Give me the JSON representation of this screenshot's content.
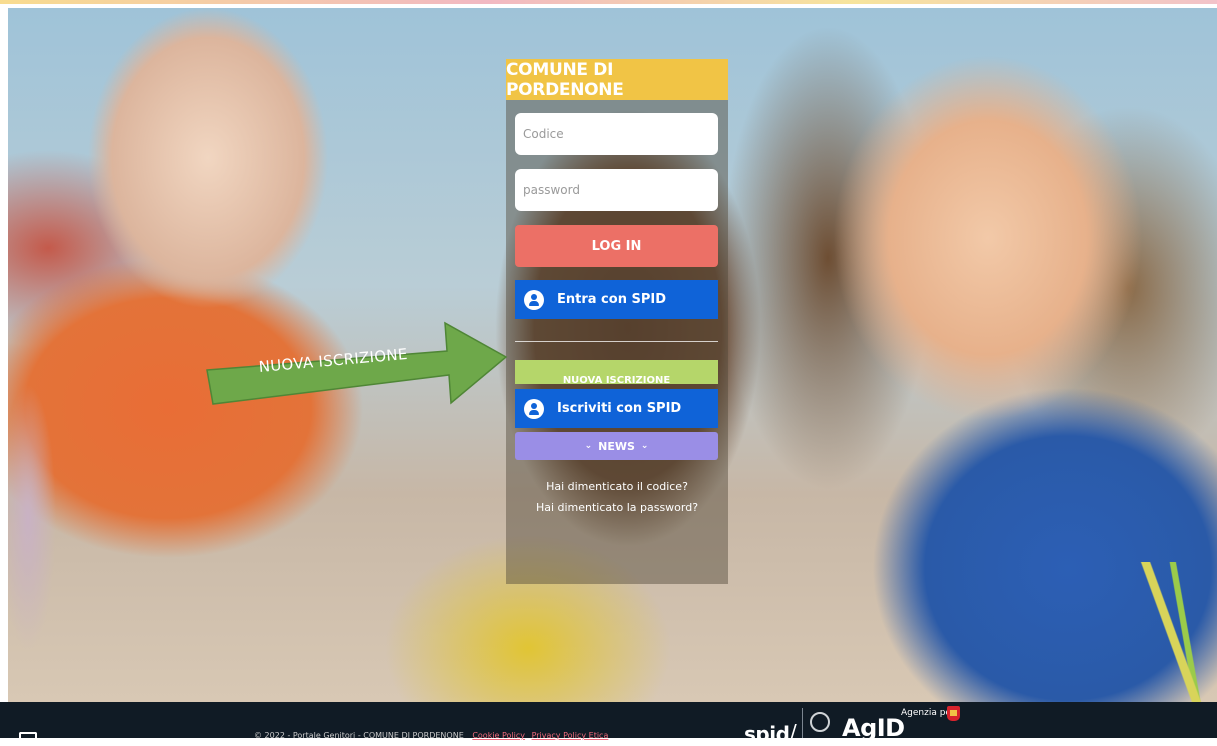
{
  "header": {
    "title": "COMUNE DI PORDENONE"
  },
  "login": {
    "code_placeholder": "Codice",
    "password_placeholder": "password",
    "login_label": "LOG IN",
    "spid_login_label": "Entra con SPID"
  },
  "registration": {
    "arrow_label": "NUOVA ISCRIZIONE",
    "button_label": "NUOVA ISCRIZIONE",
    "spid_register_label": "Iscriviti con SPID",
    "news_label": "NEWS",
    "news_chevron": "⌄"
  },
  "links": {
    "forgot_code": "Hai dimenticato il codice?",
    "forgot_password": "Hai dimenticato la password?"
  },
  "footer": {
    "copyright": "© 2022 - Portale Genitori - COMUNE DI PORDENONE",
    "cookie_policy": "Cookie Policy",
    "privacy_policy": "Privacy Policy Etica",
    "spid_logo": "spid",
    "agid_logo": "AgID",
    "agid_subtitle": "Agenzia per"
  },
  "colors": {
    "title_bar": "#f1c445",
    "login_button": "#ec7066",
    "spid_button": "#0f63d8",
    "nuova_iscrizione": "#b5d66a",
    "news_button": "#9a8ee6",
    "arrow": "#6ea84a",
    "footer_bg": "#101b25"
  },
  "icons": {
    "spid": "spid-user-icon",
    "arrow": "right-arrow-icon",
    "news_chevrons": "chevron-down-icon"
  }
}
